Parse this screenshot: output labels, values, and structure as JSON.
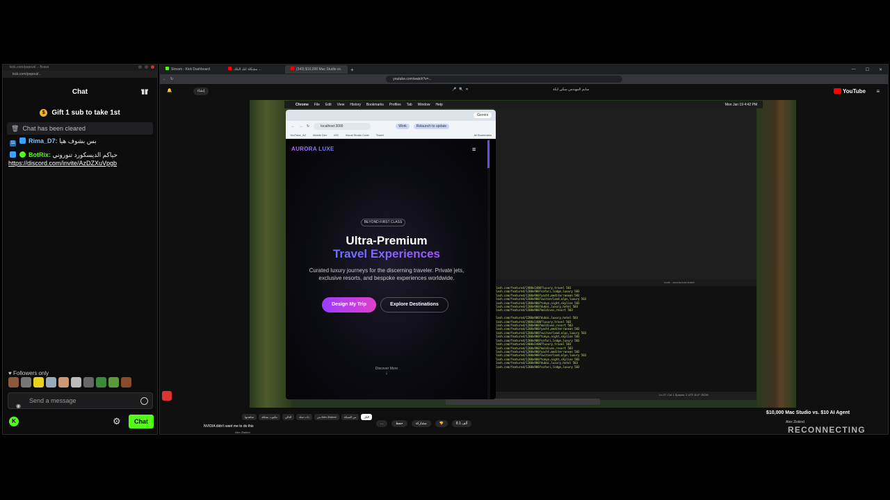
{
  "chat_window": {
    "title": "kick.com/popout/..- Brave",
    "address": "kick.com/popout/..",
    "header": "Chat",
    "gift": "Gift 1 sub to take 1st",
    "cleared": "Chat has been cleared",
    "messages": [
      {
        "badge": "11",
        "user": "Rima_D7:",
        "text": "بس بشوف هيا"
      },
      {
        "user": "BotRix:",
        "text": "حياكم الديسكورد تنوروني",
        "link": "https://discord.com/invite/AzDZXuVpgb"
      }
    ],
    "followers_only": "Followers only",
    "input_placeholder": "Send a message",
    "chat_button": "Chat"
  },
  "browser": {
    "tabs": [
      {
        "label": "Stream - Kick Dashboard",
        "color": "#53fc18"
      },
      {
        "label": "مشكلة ابك البلك ...",
        "color": "#ff0000"
      },
      {
        "label": "(343) $10,000 Mac Studio vs.",
        "color": "#ff0000"
      }
    ],
    "url": "youtube.com/watch?v=..."
  },
  "youtube": {
    "logo": "YouTube",
    "create": "إنشاء",
    "search_text": "سايم المهندس سكي ابكة",
    "video_title": "$10,000 Mac Studio vs. $10 AI Agent",
    "channel": "Alex Ziskind",
    "overlay": "RECONNECTING",
    "chips": [
      "الكل",
      "من الشبكة",
      "من Alex Ziskind",
      "ذات صلة",
      "التالي",
      "مكتوب بشكله",
      "شاهدتها"
    ],
    "actions": [
      "8.1 ألف",
      "مشاركة",
      "حفظ",
      "..."
    ],
    "side_video": "NVIDIA didn't want me to do this",
    "side_channel": "Alex Ziskind"
  },
  "mac": {
    "menu": [
      "Chrome",
      "File",
      "Edit",
      "View",
      "History",
      "Bookmarks",
      "Profiles",
      "Tab",
      "Window",
      "Help"
    ],
    "clock": "Mon Jan 19  4:42 PM",
    "chrome": {
      "gemini": "Gemini",
      "url": "localhost:3000",
      "work": "Work",
      "relaunch": "Relaunch to update",
      "bookmarks": [
        "YouTube_AZ",
        "Mobile Dev",
        "iOS",
        "Visual Studio Code",
        "Travel",
        "All Bookmarks"
      ]
    },
    "site": {
      "logo": "AURORA LUXE",
      "badge": "BEYOND FIRST CLASS",
      "headline1": "Ultra-Premium",
      "headline2": "Travel Experiences",
      "subtitle": "Curated luxury journeys for the discerning traveler. Private jets, exclusive resorts, and bespoke experiences worldwide.",
      "btn_primary": "Design My Trip",
      "btn_secondary": "Explore Destinations",
      "discover": "Discover More"
    },
    "terminal_tab": "node - aurora-luxe-travel",
    "terminal_lines": [
      "lash.com/featured/2400x1400?luxury,travel 503",
      "lash.com/featured/1200x900?safari,lodge,luxury 503",
      "lash.com/featured/1200x900?yacht,mediterranean 503",
      "lash.com/featured/1200x900?switzerland,alps,luxury 503",
      "lash.com/featured/1200x900?tokyo,night,skyline 503",
      "lash.com/featured/1200x900?dubai,luxury,hotel 503",
      "lash.com/featured/1200x900?maldives,resort 503",
      "",
      "lash.com/featured/1200x900?dubai,luxury,hotel 503",
      "lash.com/featured/2400x1400?luxury,travel 503",
      "lash.com/featured/1200x900?maldives,resort 503",
      "lash.com/featured/1200x900?yacht,mediterranean 503",
      "lash.com/featured/1200x900?switzerland,alps,luxury 503",
      "lash.com/featured/1200x900?tokyo,night,skyline 503",
      "lash.com/featured/1200x900?safari,lodge,luxury 503",
      "lash.com/featured/2400x1400?luxury,travel 503",
      "lash.com/featured/1200x900?maldives,resort 503",
      "lash.com/featured/1200x900?yacht,mediterranean 503",
      "lash.com/featured/1200x900?switzerland,alps,luxury 503",
      "lash.com/featured/1200x900?tokyo,night,skyline 503",
      "lash.com/featured/1200x900?dubai,luxury,hotel 503",
      "lash.com/featured/1200x900?safari,lodge,luxury 503"
    ],
    "status": "Ln 27, Col 1   Spaces: 2   UTF-8   LF   JSON"
  }
}
